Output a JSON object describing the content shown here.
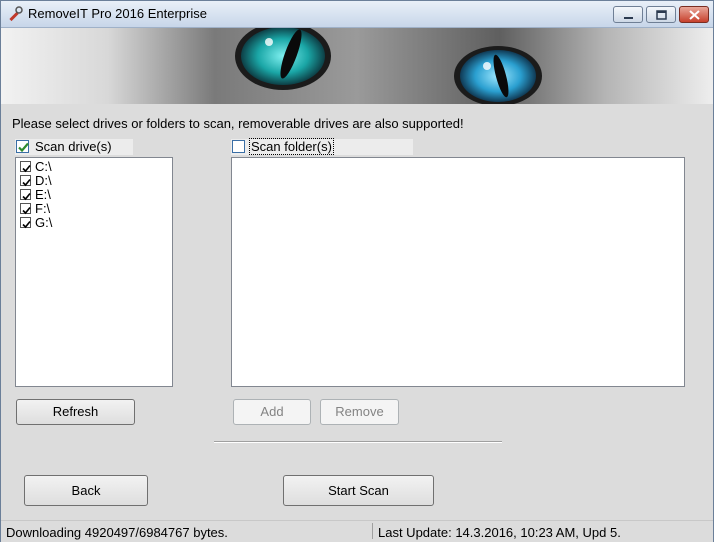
{
  "window": {
    "title": "RemoveIT Pro 2016 Enterprise",
    "icon": "wrench-icon",
    "controls": [
      "minimize-icon",
      "maximize-icon",
      "close-icon"
    ]
  },
  "banner": {
    "image": "cat-eyes-banner"
  },
  "instructions": "Please select drives or folders to scan, removerable drives are also supported!",
  "drives": {
    "label": "Scan drive(s)",
    "checked": true,
    "items": [
      {
        "label": "C:\\",
        "checked": true
      },
      {
        "label": "D:\\",
        "checked": true
      },
      {
        "label": "E:\\",
        "checked": true
      },
      {
        "label": "F:\\",
        "checked": true
      },
      {
        "label": "G:\\",
        "checked": true
      }
    ],
    "refresh_label": "Refresh"
  },
  "folders": {
    "label": "Scan folder(s)",
    "checked": false,
    "items": [],
    "add_label": "Add",
    "remove_label": "Remove"
  },
  "footer": {
    "back_label": "Back",
    "start_scan_label": "Start Scan"
  },
  "status": {
    "download": "Downloading 4920497/6984767 bytes.",
    "last_update": "Last Update: 14.3.2016, 10:23 AM, Upd 5."
  },
  "colors": {
    "accent_check": "#2e8b2e",
    "titlebar_top": "#e9f0f8",
    "titlebar_bottom": "#c7d6e9",
    "close_button": "#c7402c"
  }
}
